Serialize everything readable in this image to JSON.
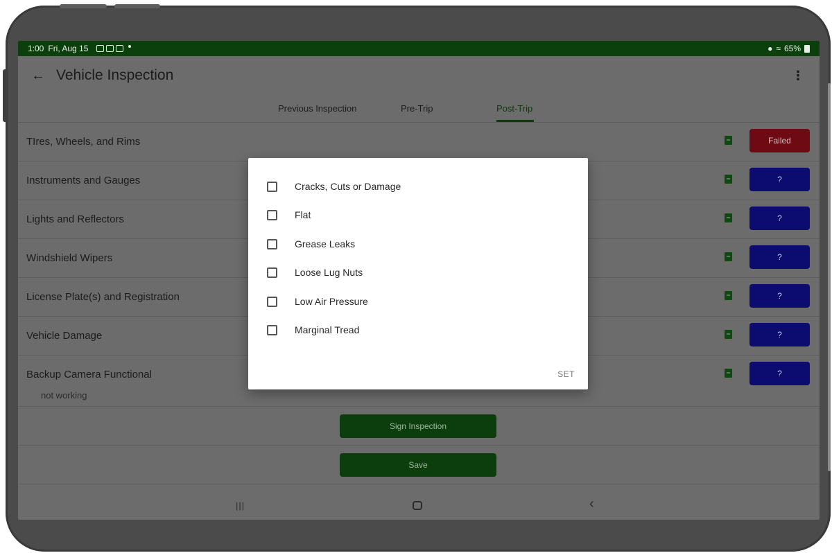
{
  "status_bar": {
    "time": "1:00",
    "date": "Fri, Aug 15",
    "battery": "65%"
  },
  "app_bar": {
    "title": "Vehicle Inspection"
  },
  "tabs": [
    {
      "label": "Previous Inspection"
    },
    {
      "label": "Pre-Trip"
    },
    {
      "label": "Post-Trip",
      "active": true
    }
  ],
  "rows": [
    {
      "label": "TIres, Wheels, and Rims",
      "status": "Failed"
    },
    {
      "label": "Instruments and Gauges",
      "status": "?"
    },
    {
      "label": "Lights and Reflectors",
      "status": "?"
    },
    {
      "label": "Windshield Wipers",
      "status": "?"
    },
    {
      "label": "License Plate(s) and Registration",
      "status": "?"
    },
    {
      "label": "Vehicle Damage",
      "status": "?"
    },
    {
      "label": "Backup Camera Functional",
      "note": "not working",
      "status": "?"
    }
  ],
  "actions": {
    "sign_label": "Sign Inspection",
    "save_label": "Save"
  },
  "dialog": {
    "options": [
      {
        "label": "Cracks, Cuts or Damage",
        "checked": false
      },
      {
        "label": "Flat",
        "checked": false
      },
      {
        "label": "Grease Leaks",
        "checked": false
      },
      {
        "label": "Loose Lug Nuts",
        "checked": false
      },
      {
        "label": "Low Air Pressure",
        "checked": false
      },
      {
        "label": "Marginal Tread",
        "checked": false
      }
    ],
    "set_label": "SET"
  },
  "colors": {
    "status_bar": "#0b3f0b",
    "failed": "#6e0a14",
    "unknown": "#0b0b70",
    "primary_green": "#0c3d0c"
  }
}
